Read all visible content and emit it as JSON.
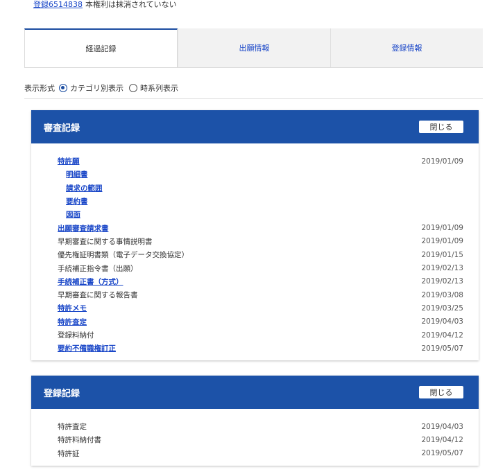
{
  "status": {
    "reg_link": "登録6514838",
    "reg_text": "本権利は抹消されていない"
  },
  "tabs": [
    {
      "label": "経過記録"
    },
    {
      "label": "出願情報"
    },
    {
      "label": "登録情報"
    }
  ],
  "display_mode": {
    "label": "表示形式",
    "option1": "カテゴリ別表示",
    "option2": "時系列表示",
    "selected": "カテゴリ別表示"
  },
  "colors": {
    "accent": "#1c52a8",
    "link": "#1a47c8"
  },
  "exam": {
    "title": "審査記録",
    "close": "閉じる",
    "rows": [
      {
        "label": "特許願",
        "date": "2019/01/09",
        "link": true,
        "sub": false
      },
      {
        "label": "明細書",
        "date": "",
        "link": true,
        "sub": true
      },
      {
        "label": "請求の範囲",
        "date": "",
        "link": true,
        "sub": true
      },
      {
        "label": "要約書",
        "date": "",
        "link": true,
        "sub": true
      },
      {
        "label": "図面",
        "date": "",
        "link": true,
        "sub": true
      },
      {
        "label": "出願審査請求書",
        "date": "2019/01/09",
        "link": true,
        "sub": false
      },
      {
        "label": "早期審査に関する事情説明書",
        "date": "2019/01/09",
        "link": false,
        "sub": false
      },
      {
        "label": "優先権証明書類（電子データ交換協定）",
        "date": "2019/01/15",
        "link": false,
        "sub": false
      },
      {
        "label": "手続補正指令書（出願）",
        "date": "2019/02/13",
        "link": false,
        "sub": false
      },
      {
        "label": "手続補正書（方式）",
        "date": "2019/02/13",
        "link": true,
        "sub": false
      },
      {
        "label": "早期審査に関する報告書",
        "date": "2019/03/08",
        "link": false,
        "sub": false
      },
      {
        "label": "特許メモ",
        "date": "2019/03/25",
        "link": true,
        "sub": false
      },
      {
        "label": "特許査定",
        "date": "2019/04/03",
        "link": true,
        "sub": false
      },
      {
        "label": "登録料納付",
        "date": "2019/04/12",
        "link": false,
        "sub": false
      },
      {
        "label": "要約不備職権訂正",
        "date": "2019/05/07",
        "link": true,
        "sub": false
      }
    ]
  },
  "reg": {
    "title": "登録記録",
    "close": "閉じる",
    "rows": [
      {
        "label": "特許査定",
        "date": "2019/04/03",
        "link": false,
        "sub": false
      },
      {
        "label": "特許料納付書",
        "date": "2019/04/12",
        "link": false,
        "sub": false
      },
      {
        "label": "特許証",
        "date": "2019/05/07",
        "link": false,
        "sub": false
      }
    ]
  }
}
